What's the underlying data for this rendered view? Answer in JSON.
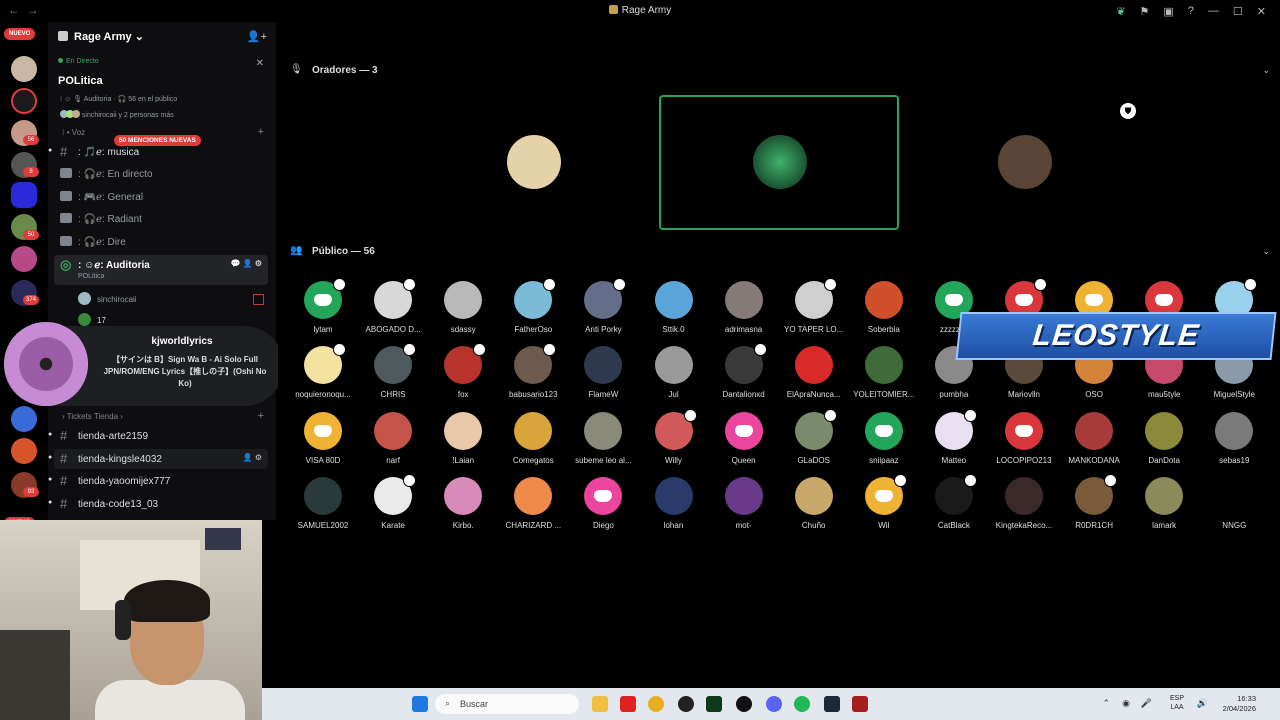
{
  "window": {
    "title": "Rage Army"
  },
  "guilds": {
    "nuevo_top": "NUEVO",
    "nuevo_bottom": "NUEVO",
    "badges": [
      "56",
      "8",
      "50",
      "374",
      "93"
    ]
  },
  "sidebar": {
    "server_name": "Rage Army",
    "live_label": "En Directo",
    "stage_name": "POLitica",
    "stage_info": "⁝ ☺ 🎙 Auditoria · 🎧 56 en el público",
    "stage_people": "sinchirocaii y 2 personas más",
    "voice_category": "Voz",
    "mentions_badge": "50 MENCIONES NUEVAS",
    "channels": [
      {
        "label": ": 🎵ℯ: musica"
      },
      {
        "label": ": 🎧ℯ: En directo"
      },
      {
        "label": ": 🎮ℯ: General"
      },
      {
        "label": ": 🎧ℯ: Radiant"
      },
      {
        "label": ": 🎧ℯ: Dire"
      }
    ],
    "active_channel": {
      "label": ": ☺ℯ: Auditoria",
      "sub": "POLitica"
    },
    "members": [
      "sinchirocaii",
      "17"
    ],
    "tickets_category": "Tickets Tienda",
    "tickets": [
      "tienda-arte2159",
      "tienda-kingsle4032",
      "tienda-yaoomijex777",
      "tienda-code13_03"
    ]
  },
  "now_playing": {
    "user": "kjworldlyrics",
    "song": "【サインは B】Sign Wa B - Ai Solo Full JPN/ROM/ENG Lyrics【推しの子】(Oshi No Ko)"
  },
  "main": {
    "speakers_header": "Oradores — 3",
    "public_header": "Público — 56",
    "speaker_colors": [
      "#9fbac5",
      "#a4e27c",
      "#c3ab87"
    ],
    "audience": [
      {
        "name": "lytam",
        "color": "#23a55a",
        "icon": "discord"
      },
      {
        "name": "ABOGADO D...",
        "color": "#d8d8d8"
      },
      {
        "name": "sdassy",
        "color": "#b9b9b9"
      },
      {
        "name": "FatherOso",
        "color": "#7bbbd6"
      },
      {
        "name": "Anti Porky",
        "color": "#646d8a"
      },
      {
        "name": "Sttik.0",
        "color": "#5aa6d9"
      },
      {
        "name": "adrimasna",
        "color": "#857a78"
      },
      {
        "name": "YO TAPER LO...",
        "color": "#cfcfcf"
      },
      {
        "name": "Soberbia",
        "color": "#d24f2b"
      },
      {
        "name": "zzzzzzz",
        "color": "#23a55a",
        "icon": "discord"
      },
      {
        "name": "",
        "color": "#da373c",
        "icon": "discord"
      },
      {
        "name": "",
        "color": "#f0b232",
        "icon": "discord"
      },
      {
        "name": "",
        "color": "#da373c",
        "icon": "discord"
      },
      {
        "name": "",
        "color": "#9ad2ee"
      },
      {
        "name": "noquieronoqu...",
        "color": "#f3e2a0"
      },
      {
        "name": "CHRIS",
        "color": "#4e5a5e"
      },
      {
        "name": "fox",
        "color": "#b6342b"
      },
      {
        "name": "babusario123",
        "color": "#6c5a4e"
      },
      {
        "name": "FlameW",
        "color": "#303a4e"
      },
      {
        "name": "Jul",
        "color": "#9a9a9a"
      },
      {
        "name": "Dantalionxd",
        "color": "#3a3a3a"
      },
      {
        "name": "ElApraNunca...",
        "color": "#d92a2a"
      },
      {
        "name": "YOLEITOMIER...",
        "color": "#3f6a3a"
      },
      {
        "name": "pumbha",
        "color": "#8a8a8a"
      },
      {
        "name": "Mariovlln",
        "color": "#5a4a3a"
      },
      {
        "name": "OSO",
        "color": "#d4843a"
      },
      {
        "name": "mau5tyle",
        "color": "#c84a6a"
      },
      {
        "name": "MiguelStyle",
        "color": "#8a9aa8"
      },
      {
        "name": "VISA 80D",
        "color": "#f0b232",
        "icon": "discord"
      },
      {
        "name": "narf",
        "color": "#c4544a"
      },
      {
        "name": "!Laian",
        "color": "#e8c8a8"
      },
      {
        "name": "Comegatos",
        "color": "#d9a43a"
      },
      {
        "name": "subeme leo al...",
        "color": "#8a8a7a"
      },
      {
        "name": "Willy",
        "color": "#d05a5a"
      },
      {
        "name": "Queen",
        "color": "#eb459e",
        "icon": "discord"
      },
      {
        "name": "GLaDOS",
        "color": "#7a8a6a"
      },
      {
        "name": "sniipaaz",
        "color": "#23a55a",
        "icon": "discord"
      },
      {
        "name": "Matteo",
        "color": "#e8e0f0"
      },
      {
        "name": "LOCOPIPO213",
        "color": "#da373c",
        "icon": "discord"
      },
      {
        "name": "MANKODANA",
        "color": "#a83a3a"
      },
      {
        "name": "DanDota",
        "color": "#8a8a3a"
      },
      {
        "name": "sebas19",
        "color": "#7a7a7a"
      },
      {
        "name": "SAMUEL2002",
        "color": "#2a3a3a"
      },
      {
        "name": "Karate",
        "color": "#eaeaea"
      },
      {
        "name": "Kirbo.",
        "color": "#d88ab8"
      },
      {
        "name": "CHARIZARD ...",
        "color": "#f08a4a"
      },
      {
        "name": "Diego",
        "color": "#eb459e",
        "icon": "discord"
      },
      {
        "name": "lohan",
        "color": "#2a3a6a"
      },
      {
        "name": "mot-",
        "color": "#6a3a8a"
      },
      {
        "name": "Chuño",
        "color": "#c8a86a"
      },
      {
        "name": "Wil",
        "color": "#f0b232",
        "icon": "discord"
      },
      {
        "name": "CatBlack",
        "color": "#1a1a1a"
      },
      {
        "name": "KingtekaReco...",
        "color": "#3a2a2a"
      },
      {
        "name": "R0DR1CH",
        "color": "#7a5a3a"
      },
      {
        "name": "lamark",
        "color": "#8a8a5a"
      },
      {
        "name": "NNGG",
        "color": "#000000"
      }
    ]
  },
  "overlay": {
    "text": "LEOSTYLE"
  },
  "taskbar": {
    "search_placeholder": "Buscar",
    "lang_top": "ESP",
    "lang_bottom": "LAA",
    "time": "16:33",
    "date": "2/04/2026"
  }
}
